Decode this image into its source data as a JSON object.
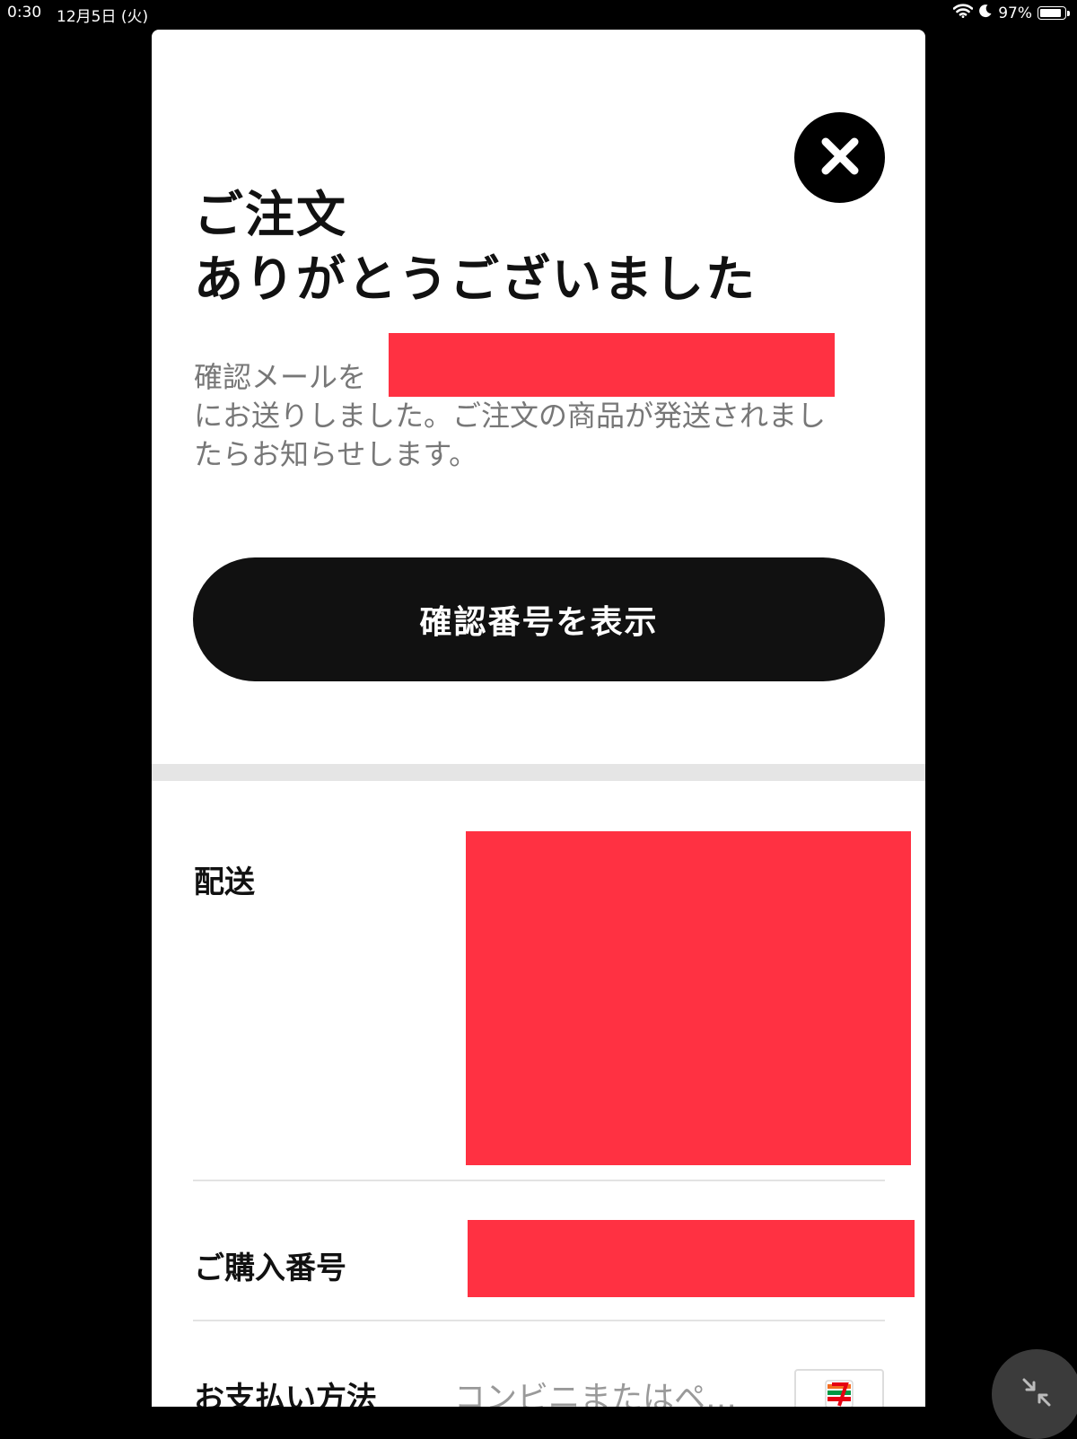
{
  "status_bar": {
    "time": "0:30",
    "date": "12月5日 (火)",
    "battery": "97%",
    "battery_level": 0.97
  },
  "modal": {
    "title_line1": "ご注文",
    "title_line2": "ありがとうございました",
    "message_prefix": "確認メールを",
    "message_rest": "にお送りしました。ご注文の商品が発送されましたらお知らせします。",
    "confirm_button": "確認番号を表示",
    "rows": {
      "delivery_label": "配送",
      "purchase_number_label": "ご購入番号",
      "payment_label": "お支払い方法",
      "payment_value": "コンビニまたはペ…"
    }
  },
  "colors": {
    "redaction": "#ff3142",
    "button_bg": "#111111",
    "page_bg": "#000000"
  },
  "icons": [
    "wifi-icon",
    "moon-icon",
    "battery-icon",
    "close-icon",
    "seven-eleven-logo",
    "minimize-icon"
  ]
}
